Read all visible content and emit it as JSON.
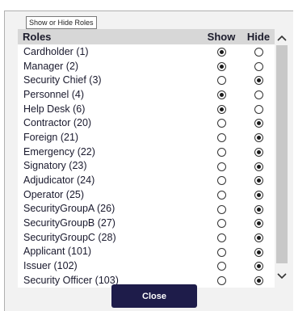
{
  "panel": {
    "legend": "Show or Hide Roles"
  },
  "table": {
    "headers": {
      "roles": "Roles",
      "show": "Show",
      "hide": "Hide"
    },
    "rows": [
      {
        "label": "Cardholder (1)",
        "selected": "show"
      },
      {
        "label": "Manager (2)",
        "selected": "show"
      },
      {
        "label": "Security Chief (3)",
        "selected": "hide"
      },
      {
        "label": "Personnel (4)",
        "selected": "show"
      },
      {
        "label": "Help Desk (6)",
        "selected": "show"
      },
      {
        "label": "Contractor (20)",
        "selected": "hide"
      },
      {
        "label": "Foreign (21)",
        "selected": "hide"
      },
      {
        "label": "Emergency (22)",
        "selected": "hide"
      },
      {
        "label": "Signatory (23)",
        "selected": "hide"
      },
      {
        "label": "Adjudicator (24)",
        "selected": "hide"
      },
      {
        "label": "Operator (25)",
        "selected": "hide"
      },
      {
        "label": "SecurityGroupA (26)",
        "selected": "hide"
      },
      {
        "label": "SecurityGroupB (27)",
        "selected": "hide"
      },
      {
        "label": "SecurityGroupC (28)",
        "selected": "hide"
      },
      {
        "label": "Applicant (101)",
        "selected": "hide"
      },
      {
        "label": "Issuer (102)",
        "selected": "hide"
      },
      {
        "label": "Security Officer (103)",
        "selected": "hide"
      }
    ]
  },
  "scrollbar": {
    "up_icon": "chevron-up-icon",
    "down_icon": "chevron-down-icon"
  },
  "footer": {
    "close_label": "Close"
  },
  "colors": {
    "button_bg": "#1e1c4a",
    "header_bg": "#d7d7d7"
  }
}
